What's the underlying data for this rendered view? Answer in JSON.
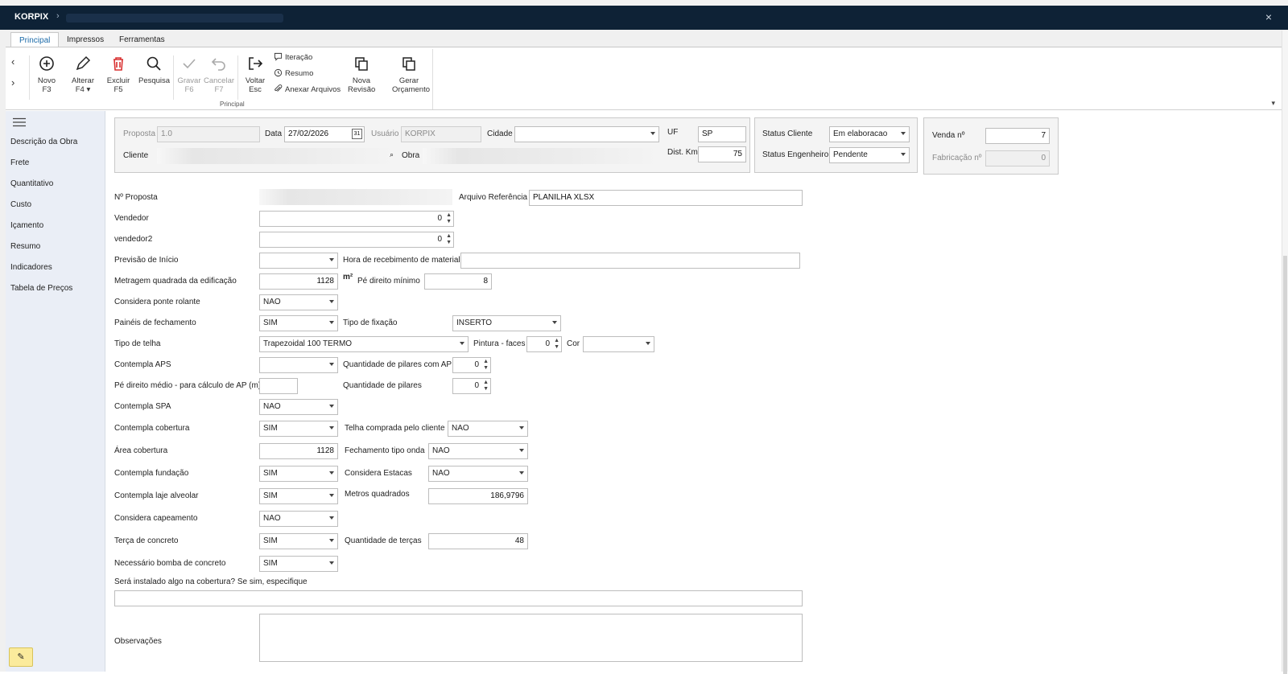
{
  "titlebar": {
    "app": "KORPIX",
    "chevron": "›",
    "close": "×"
  },
  "tabs": [
    "Principal",
    "Impressos",
    "Ferramentas"
  ],
  "ribbon": {
    "novo": [
      "Novo",
      "F3"
    ],
    "alterar": [
      "Alterar",
      "F4"
    ],
    "excluir": [
      "Excluir",
      "F5"
    ],
    "pesquisa": [
      "Pesquisa",
      ""
    ],
    "gravar": [
      "Gravar",
      "F6"
    ],
    "cancelar": [
      "Cancelar",
      "F7"
    ],
    "voltar": [
      "Voltar",
      "Esc"
    ],
    "iteracao": "Iteração",
    "resumo": "Resumo",
    "anexar": "Anexar Arquivos",
    "nova_revisao": [
      "Nova",
      "Revisão"
    ],
    "gerar_orcamento": [
      "Gerar",
      "Orçamento"
    ],
    "group_label": "Principal"
  },
  "sidebar": [
    "Descrição da Obra",
    "Frete",
    "Quantitativo",
    "Custo",
    "Içamento",
    "Resumo",
    "Indicadores",
    "Tabela de Preços"
  ],
  "header": {
    "proposta_label": "Proposta",
    "proposta_value": "1.0",
    "data_label": "Data",
    "data_value": "27/02/2026",
    "usuario_label": "Usuário",
    "usuario_value": "KORPIX",
    "cidade_label": "Cidade",
    "cidade_value": "",
    "uf_label": "UF",
    "uf_value": "SP",
    "cliente_label": "Cliente",
    "obra_label": "Obra",
    "dist_label": "Dist. Km",
    "dist_value": "75",
    "status_cliente_label": "Status Cliente",
    "status_cliente_value": "Em elaboracao",
    "status_eng_label": "Status Engenheiro",
    "status_eng_value": "Pendente",
    "venda_label": "Venda nº",
    "venda_value": "7",
    "fabricacao_label": "Fabricação nº",
    "fabricacao_value": "0"
  },
  "form": {
    "nproposta": "Nº Proposta",
    "arquivo_ref_label": "Arquivo Referência",
    "arquivo_ref_value": "PLANILHA XLSX",
    "vendedor": "Vendedor",
    "vendedor_value": "0",
    "vendedor2": "vendedor2",
    "vendedor2_value": "0",
    "previsao": "Previsão de Início",
    "previsao_value": "",
    "hora_label": "Hora de recebimento de material",
    "hora_value": "",
    "metragem": "Metragem quadrada da edificação",
    "metragem_value": "1128",
    "m2": "m²",
    "pe_direito_min": "Pé direito mínimo",
    "pe_direito_min_value": "8",
    "ponte": "Considera ponte rolante",
    "ponte_value": "NAO",
    "paineis": "Painéis de fechamento",
    "paineis_value": "SIM",
    "tipo_fixacao": "Tipo de fixação",
    "tipo_fixacao_value": "INSERTO",
    "tipo_telha": "Tipo de telha",
    "tipo_telha_value": "Trapezoidal 100 TERMO",
    "pintura": "Pintura - faces",
    "pintura_value": "0",
    "cor": "Cor",
    "cor_value": "",
    "aps": "Contempla APS",
    "aps_value": "",
    "qtd_pilares_ap": "Quantidade de pilares com AP",
    "qtd_pilares_ap_value": "0",
    "pe_direito_medio": "Pé direito médio - para cálculo de AP (m)",
    "pe_direito_medio_value": "",
    "qtd_pilares": "Quantidade de pilares",
    "qtd_pilares_value": "0",
    "spa": "Contempla SPA",
    "spa_value": "NAO",
    "cobertura": "Contempla cobertura",
    "cobertura_value": "SIM",
    "telha_cliente": "Telha comprada pelo cliente",
    "telha_cliente_value": "NAO",
    "area_cobertura": "Área cobertura",
    "area_cobertura_value": "1128",
    "fech_onda": "Fechamento tipo onda",
    "fech_onda_value": "NAO",
    "fundacao": "Contempla fundação",
    "fundacao_value": "SIM",
    "estacas": "Considera Estacas",
    "estacas_value": "NAO",
    "laje": "Contempla laje alveolar",
    "laje_value": "SIM",
    "metros_quadrados": "Metros quadrados",
    "metros_quadrados_value": "186,9796",
    "capeamento": "Considera capeamento",
    "capeamento_value": "NAO",
    "terca": "Terça de concreto",
    "terca_value": "SIM",
    "qtd_tercas": "Quantidade de terças",
    "qtd_tercas_value": "48",
    "bomba": "Necessário bomba de concreto",
    "bomba_value": "SIM",
    "instalado": "Será instalado algo na cobertura? Se sim, especifique",
    "observacoes": "Observações"
  }
}
